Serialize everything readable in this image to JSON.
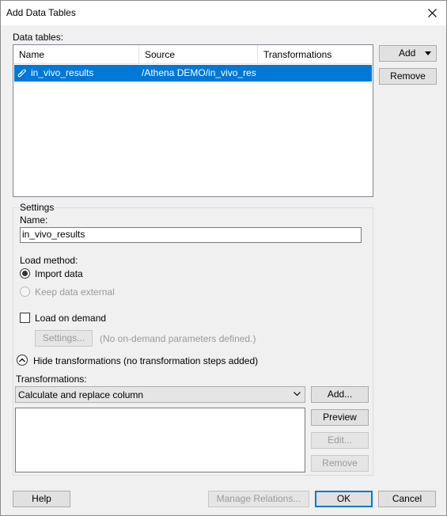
{
  "window": {
    "title": "Add Data Tables"
  },
  "data_tables": {
    "label": "Data tables:",
    "columns": [
      "Name",
      "Source",
      "Transformations"
    ],
    "rows": [
      {
        "name": "in_vivo_results",
        "source": "/Athena DEMO/in_vivo_res...",
        "transformations": ""
      }
    ],
    "add_label": "Add",
    "remove_label": "Remove"
  },
  "settings": {
    "group_label": "Settings",
    "name_label": "Name:",
    "name_value": "in_vivo_results",
    "load_method_label": "Load method:",
    "import_data_label": "Import data",
    "keep_external_label": "Keep data external",
    "load_on_demand_label": "Load on demand",
    "settings_button_label": "Settings...",
    "on_demand_note": "(No on-demand parameters defined.)",
    "hide_transformations_label": "Hide transformations (no transformation steps added)",
    "transformations_label": "Transformations:",
    "transformation_selected": "Calculate and replace column",
    "add_button_label": "Add...",
    "preview_button_label": "Preview",
    "edit_button_label": "Edit...",
    "remove_button_label": "Remove"
  },
  "footer": {
    "help_label": "Help",
    "manage_relations_label": "Manage Relations...",
    "ok_label": "OK",
    "cancel_label": "Cancel"
  }
}
